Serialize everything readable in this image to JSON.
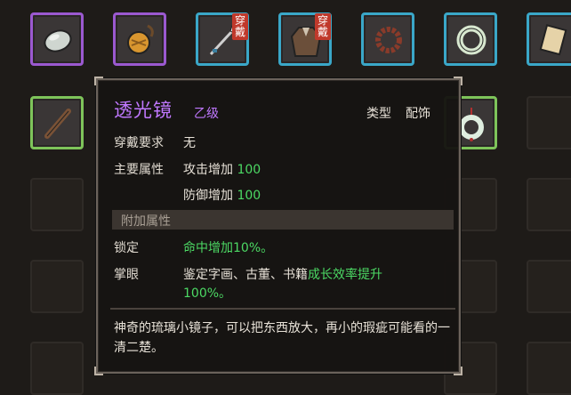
{
  "item": {
    "name": "透光镜",
    "grade": "乙级",
    "type_label": "类型",
    "type_value": "配饰",
    "equip_req_label": "穿戴要求",
    "equip_req_value": "无",
    "main_attr_label": "主要属性",
    "main_attrs": [
      {
        "name": "攻击增加 ",
        "value": "100"
      },
      {
        "name": "防御增加 ",
        "value": "100"
      }
    ],
    "extra_section_label": "附加属性",
    "extra_attrs": [
      {
        "label": "锁定",
        "text": "命中增加10%。"
      },
      {
        "label": "掌眼",
        "text_pre": "鉴定字画、古董、书籍",
        "text_green": "成长效率提升",
        "text_line2": "100%。"
      }
    ],
    "description": "神奇的琉璃小镜子，可以把东西放大，再小的瑕疵可能看的一清二楚。"
  },
  "badges": {
    "equipped": "穿戴"
  },
  "colors": {
    "purple": "#9b59d0",
    "blue": "#3aa7c8",
    "green": "#7ec45a",
    "name": "#c078ff",
    "positive": "#4cd964"
  },
  "slots": [
    {
      "icon": "jade-stone-icon",
      "rarity": "purple"
    },
    {
      "icon": "gold-pouch-icon",
      "rarity": "purple"
    },
    {
      "icon": "spear-icon",
      "rarity": "blue",
      "equipped": true
    },
    {
      "icon": "robe-icon",
      "rarity": "blue",
      "equipped": true
    },
    {
      "icon": "prayer-beads-icon",
      "rarity": "blue"
    },
    {
      "icon": "jade-ring-icon",
      "rarity": "blue"
    },
    {
      "icon": "scroll-icon",
      "rarity": "blue"
    },
    {
      "icon": "wooden-stick-icon",
      "rarity": "green"
    },
    {
      "icon": "jade-pendant-icon",
      "rarity": "green"
    }
  ]
}
